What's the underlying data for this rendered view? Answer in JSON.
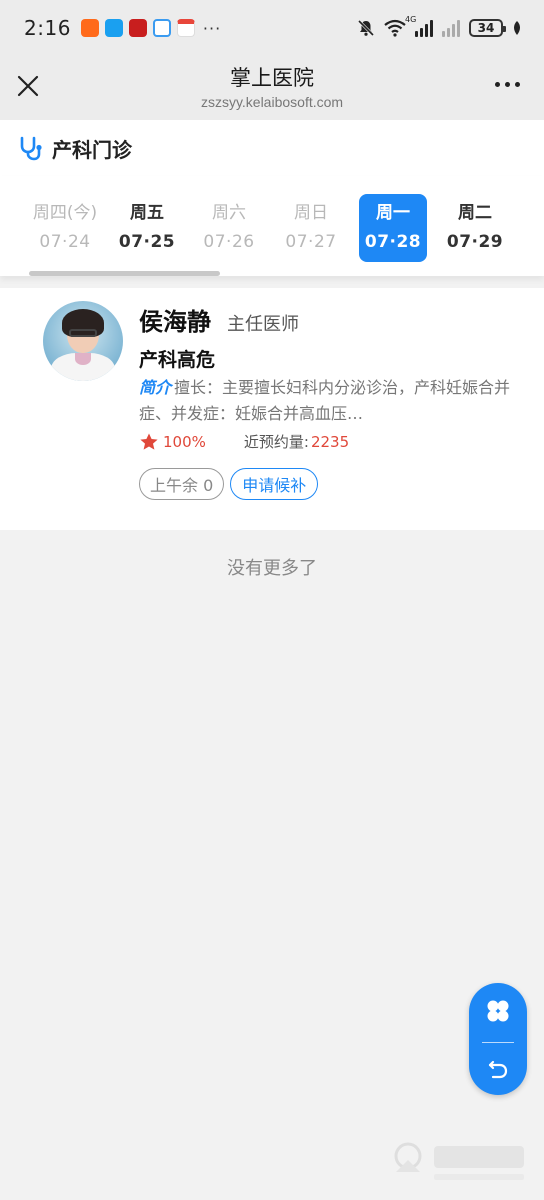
{
  "status_bar": {
    "time": "2:16",
    "battery": "34",
    "network": "4G",
    "app_icons": [
      "taobao-app-icon",
      "messages-app-icon",
      "news-app-icon",
      "browser-app-icon",
      "calendar-app-icon"
    ],
    "more": "···"
  },
  "title_bar": {
    "title": "掌上医院",
    "url": "zszsyy.kelaibosoft.com"
  },
  "department": {
    "name": "产科门诊",
    "icon": "stethoscope-icon"
  },
  "date_tabs": [
    {
      "dow": "周四(今)",
      "date": "07·24",
      "state": "disabled"
    },
    {
      "dow": "周五",
      "date": "07·25",
      "state": "enabled"
    },
    {
      "dow": "周六",
      "date": "07·26",
      "state": "disabled"
    },
    {
      "dow": "周日",
      "date": "07·27",
      "state": "disabled"
    },
    {
      "dow": "周一",
      "date": "07·28",
      "state": "active"
    },
    {
      "dow": "周二",
      "date": "07·29",
      "state": "enabled"
    }
  ],
  "doctor": {
    "name": "侯海静",
    "title": "主任医师",
    "department": "产科高危",
    "intro_tag": "简介",
    "intro_text": "擅长：主要擅长妇科内分泌诊治，产科妊娠合并症、并发症：妊娠合并高血压…",
    "rating": "100%",
    "booked_label": "近预约量:",
    "booked_value": "2235",
    "slot_label": "上午余 0",
    "waitlist_label": "申请候补"
  },
  "footer_text": "没有更多了",
  "colors": {
    "accent": "#1e88f5",
    "highlight": "#e0483a"
  }
}
